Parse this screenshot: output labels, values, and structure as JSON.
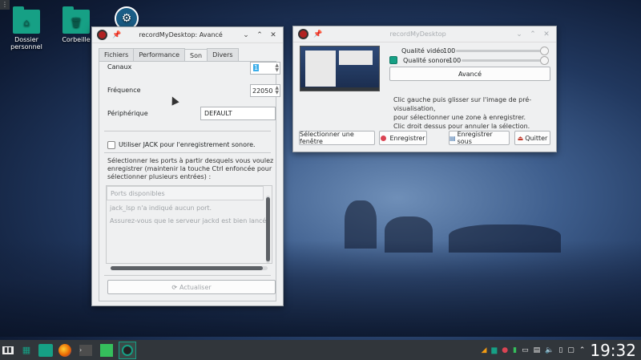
{
  "desktop": {
    "icons": [
      {
        "label": "Dossier\npersonnel"
      },
      {
        "label": "Corbeille"
      },
      {
        "label": ""
      }
    ]
  },
  "advanced_window": {
    "title": "recordMyDesktop: Avancé",
    "tabs": [
      "Fichiers",
      "Performance",
      "Son",
      "Divers"
    ],
    "active_tab": "Son",
    "channels_label": "Canaux",
    "channels_value": "1",
    "frequency_label": "Fréquence",
    "frequency_value": "22050",
    "device_label": "Périphérique",
    "device_value": "DEFAULT",
    "jack_checkbox_label": "Utiliser JACK pour l'enregistrement sonore.",
    "ports_instructions": "Sélectionner les ports à partir desquels vous voulez enregistrer (maintenir la touche Ctrl enfoncée pour sélectionner plusieurs entrées) :",
    "ports_header": "Ports disponibles",
    "ports_msg1": "jack_lsp n'a indiqué aucun port.",
    "ports_msg2": "Assurez-vous que le serveur jackd est bien lancé.",
    "refresh_button": "Actualiser"
  },
  "main_window": {
    "title": "recordMyDesktop",
    "video_quality_label": "Qualité vidéo",
    "video_quality_value": "100",
    "sound_quality_label": "Qualité sonore",
    "sound_quality_value": "100",
    "advanced_button": "Avancé",
    "help_line1": "Clic gauche puis glisser sur l'image de pré-visualisation,",
    "help_line2": "pour sélectionner une zone à enregistrer.",
    "help_line3": "Clic droit dessus pour annuler la sélection.",
    "select_window_button": "Sélectionner une fenêtre",
    "record_button": "Enregistrer",
    "save_as_button": "Enregistrer sous",
    "quit_button": "Quitter"
  },
  "taskbar": {
    "clock": "19:32"
  },
  "colors": {
    "accent": "#16a085",
    "taskbar": "#31363b",
    "record": "#da4453"
  }
}
